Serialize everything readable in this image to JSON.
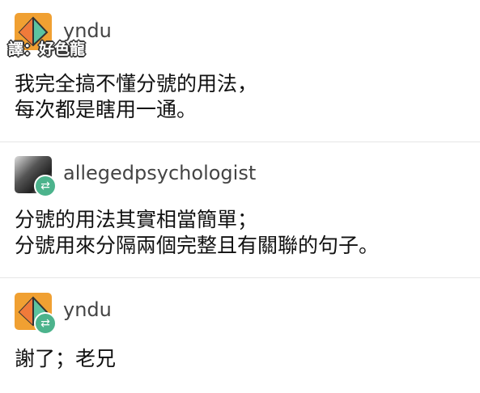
{
  "watermark": "譯：好色龍",
  "posts": [
    {
      "username": "yndu",
      "avatar": "orange-geometric-avatar",
      "reblog": false,
      "lines": [
        "我完全搞不懂分號的用法，",
        "每次都是瞎用一通。"
      ]
    },
    {
      "username": "allegedpsychologist",
      "avatar": "photo-avatar",
      "reblog": true,
      "lines": [
        "分號的用法其實相當簡單；",
        "分號用來分隔兩個完整且有關聯的句子。"
      ]
    },
    {
      "username": "yndu",
      "avatar": "orange-geometric-avatar",
      "reblog": true,
      "lines": [
        "謝了；老兄"
      ]
    }
  ],
  "colors": {
    "reblog_badge": "#4cb38c",
    "avatar_orange": "#f0a032"
  }
}
